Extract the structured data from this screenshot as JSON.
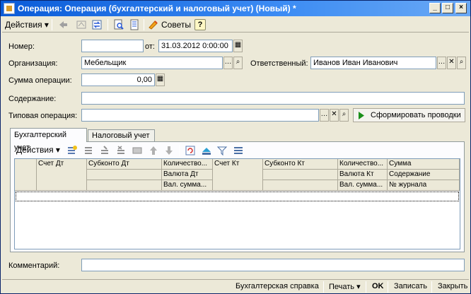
{
  "window": {
    "title": "Операция: Операция (бухгалтерский и налоговый учет) (Новый) *",
    "minimize": "_",
    "maximize": "□",
    "close": "×"
  },
  "toolbar": {
    "actions_label": "Действия",
    "advice_label": "Советы",
    "help_label": "?"
  },
  "form": {
    "number_label": "Номер:",
    "number_value": "",
    "date_from_label": "от:",
    "date_value": "31.03.2012  0:00:00",
    "org_label": "Организация:",
    "org_value": "Мебельщик",
    "responsible_label": "Ответственный:",
    "responsible_value": "Иванов Иван Иванович",
    "sum_label": "Сумма операции:",
    "sum_value": "0,00",
    "content_label": "Содержание:",
    "content_value": "",
    "typical_label": "Типовая операция:",
    "typical_value": "",
    "generate_button": "Сформировать проводки",
    "comment_label": "Комментарий:",
    "comment_value": ""
  },
  "tabs": [
    {
      "label": "Бухгалтерский учет",
      "active": true
    },
    {
      "label": "Налоговый учет",
      "active": false
    }
  ],
  "grid": {
    "actions_label": "Действия",
    "columns": {
      "account_dt": "Счет Дт",
      "subconto_dt": "Субконто Дт",
      "qty_dt": "Количество...",
      "currency_dt": "Валюта Дт",
      "val_sum_dt": "Вал. сумма...",
      "account_kt": "Счет Кт",
      "subconto_kt": "Субконто Кт",
      "qty_kt": "Количество...",
      "currency_kt": "Валюта Кт",
      "val_sum_kt": "Вал. сумма...",
      "sum": "Сумма",
      "content": "Содержание",
      "journal": "№ журнала"
    }
  },
  "bottom": {
    "accounting_report": "Бухгалтерская справка",
    "print": "Печать",
    "ok": "OK",
    "save": "Записать",
    "close": "Закрыть"
  },
  "colors": {
    "title_bar": "#0a5bd8",
    "window_bg": "#ece9d8",
    "generate_icon": "#1a8f1a"
  }
}
